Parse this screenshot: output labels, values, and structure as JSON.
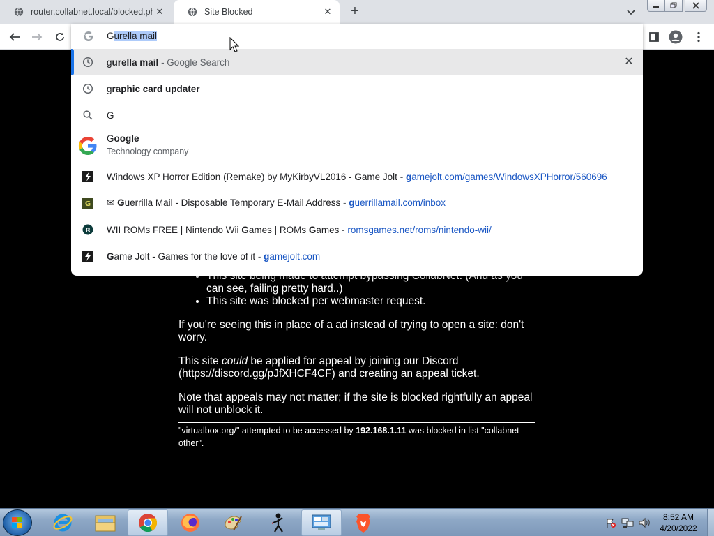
{
  "browser": {
    "tabs": [
      {
        "title": "router.collabnet.local/blocked.php",
        "favicon": "globe-icon",
        "active": false
      },
      {
        "title": "Site Blocked",
        "favicon": "globe-icon",
        "active": true
      }
    ],
    "omnibox": {
      "typed_prefix": "G",
      "autocompleted": "urella mail",
      "suggestions": [
        {
          "type": "history",
          "icon": "clock-icon",
          "prefix": "g",
          "bold": "urella mail",
          "suffix": " - Google Search",
          "removable": true,
          "selected": true
        },
        {
          "type": "history",
          "icon": "clock-icon",
          "prefix": "g",
          "bold": "raphic card updater",
          "suffix": ""
        },
        {
          "type": "search",
          "icon": "search-icon",
          "text": "G"
        },
        {
          "type": "entity",
          "icon": "google-logo-icon",
          "prefix": "G",
          "bold": "oogle",
          "subtitle": "Technology company"
        },
        {
          "type": "site",
          "icon": "gamejolt-icon",
          "pre": "Windows XP Horror Edition (Remake) by MyKirbyVL2016 - ",
          "b1": "G",
          "mid": "ame Jolt",
          "sep": " - ",
          "url_b": "g",
          "url": "amejolt.com/games/WindowsXPHorror/560696"
        },
        {
          "type": "site",
          "icon": "guerrillamail-icon",
          "pre": "✉ ",
          "b1": "G",
          "mid": "uerrilla Mail - Disposable Temporary E-Mail Address",
          "sep": " - ",
          "url_b": "g",
          "url": "uerrillamail.com/inbox"
        },
        {
          "type": "site",
          "icon": "romsgames-icon",
          "pre": "WII ROMs FREE | Nintendo Wii ",
          "b1": "G",
          "mid": "ames | ROMs ",
          "b2": "G",
          "mid2": "ames",
          "sep": " - ",
          "url": "romsgames.net/roms/nintendo-wii/"
        },
        {
          "type": "site",
          "icon": "gamejolt-icon",
          "b1": "G",
          "mid": "ame Jolt - Games for the love of it",
          "sep": " - ",
          "url_b": "g",
          "url": "amejolt.com"
        }
      ]
    }
  },
  "page": {
    "bullets": [
      "This site being made to attempt bypassing CollabNet. (And as you can see, failing pretty hard..)",
      "This site was blocked per webmaster request."
    ],
    "para1": "If you're seeing this in place of a ad instead of trying to open a site: don't worry.",
    "para2_a": "This site ",
    "para2_em": "could",
    "para2_b": " be applied for appeal by joining our Discord (https://discord.gg/pJfXHCF4CF) and creating an appeal ticket.",
    "para3": "Note that appeals may not matter; if the site is blocked rightfully an appeal will not unblock it.",
    "foot_a": "\"virtualbox.org/\" attempted to be accessed by ",
    "foot_ip": "192.168.1.11",
    "foot_b": " was blocked in list \"collabnet-other\"."
  },
  "taskbar": {
    "apps": [
      "internet-explorer-icon",
      "file-explorer-icon",
      "chrome-icon",
      "firefox-icon",
      "paint-icon",
      "stickman-app-icon",
      "control-panel-icon",
      "brave-icon"
    ],
    "clock_time": "8:52 AM",
    "clock_date": "4/20/2022"
  },
  "colors": {
    "accent": "#1a73e8",
    "url": "#1a57c4",
    "tab_strip": "#dee1e6"
  }
}
